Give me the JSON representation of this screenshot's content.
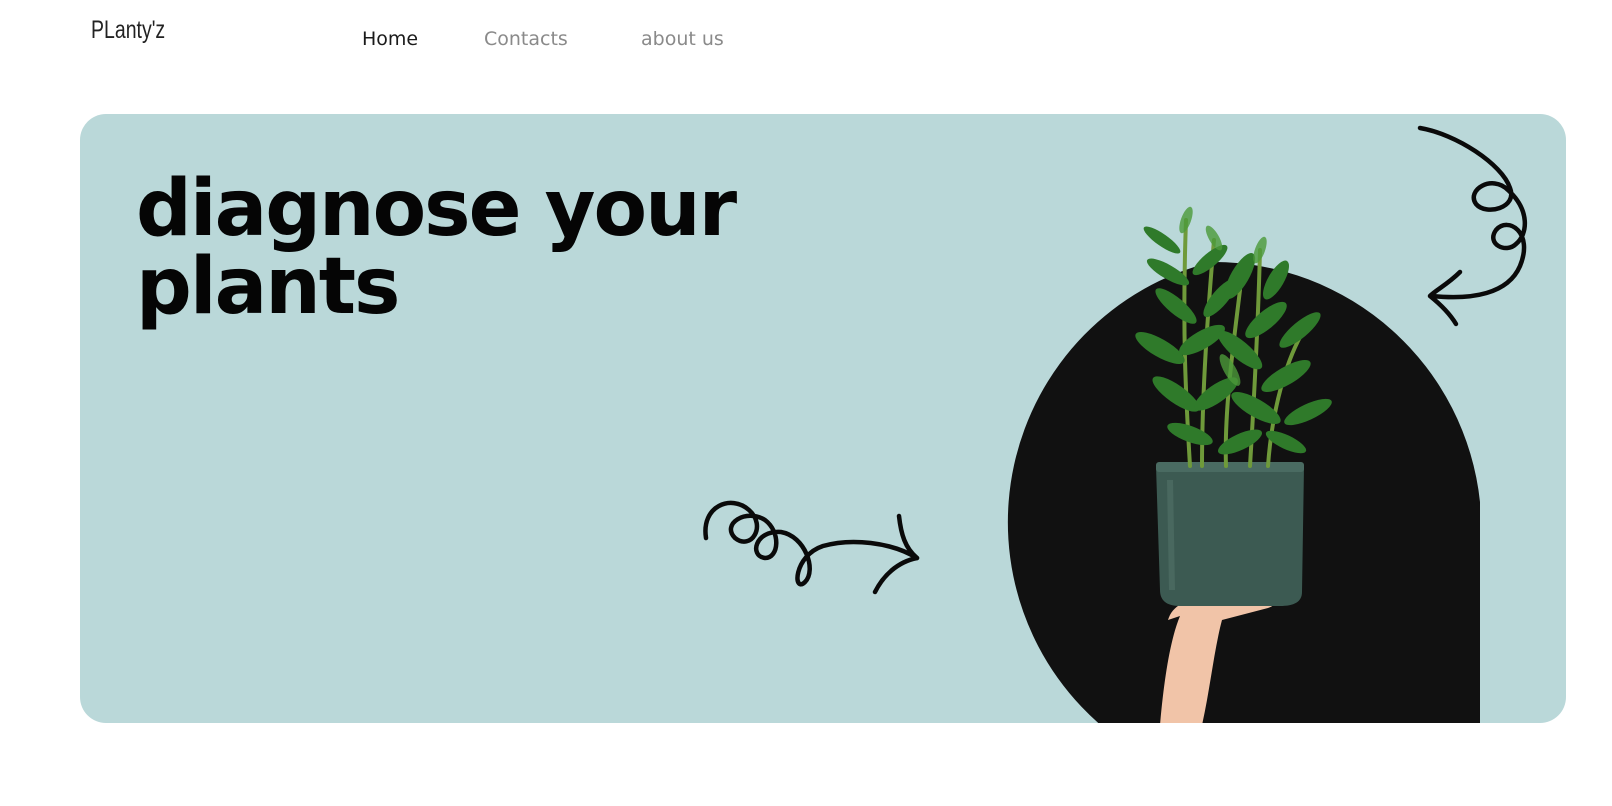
{
  "brand": {
    "logo_text": "PLanty'z"
  },
  "nav": {
    "items": [
      {
        "label": "Home",
        "active": true
      },
      {
        "label": "Contacts",
        "active": false
      },
      {
        "label": "about us",
        "active": false
      }
    ]
  },
  "hero": {
    "title_line1": "diagnose your",
    "title_line2": "plants",
    "background_color": "#bad8d9",
    "arch_color": "#111111",
    "decorations": [
      "swirl-arrow-icon",
      "swirl-arrow-icon"
    ],
    "image": "hand-holding-potted-plant"
  }
}
